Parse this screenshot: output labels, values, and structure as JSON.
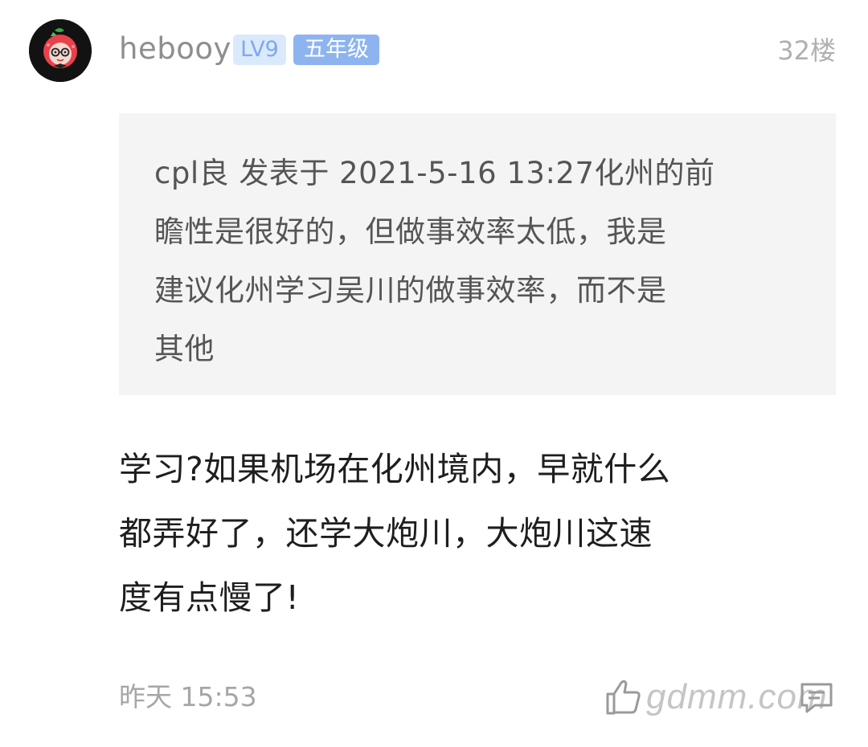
{
  "post": {
    "username": "hebooy",
    "level_badge": "LV9",
    "grade_badge": "五年级",
    "floor": "32楼",
    "quote": "cpl良 发表于 2021-5-16 13:27化州的前\n瞻性是很好的，但做事效率太低，我是\n建议化州学习吴川的做事效率，而不是\n其他",
    "content": "学习?如果机场在化州境内，早就什么\n都弄好了，还学大炮川，大炮川这速\n度有点慢了!",
    "timestamp": "昨天 15:53",
    "watermark": "gdmm.com"
  },
  "icons": {
    "avatar": "lychee-cartoon-avatar",
    "like": "thumbs-up-icon",
    "reply": "reply-bubble-icon"
  },
  "colors": {
    "badge_level_bg": "#dbe9fd",
    "badge_grade_bg": "#8eb4ef",
    "quote_bg": "#f4f4f4"
  }
}
